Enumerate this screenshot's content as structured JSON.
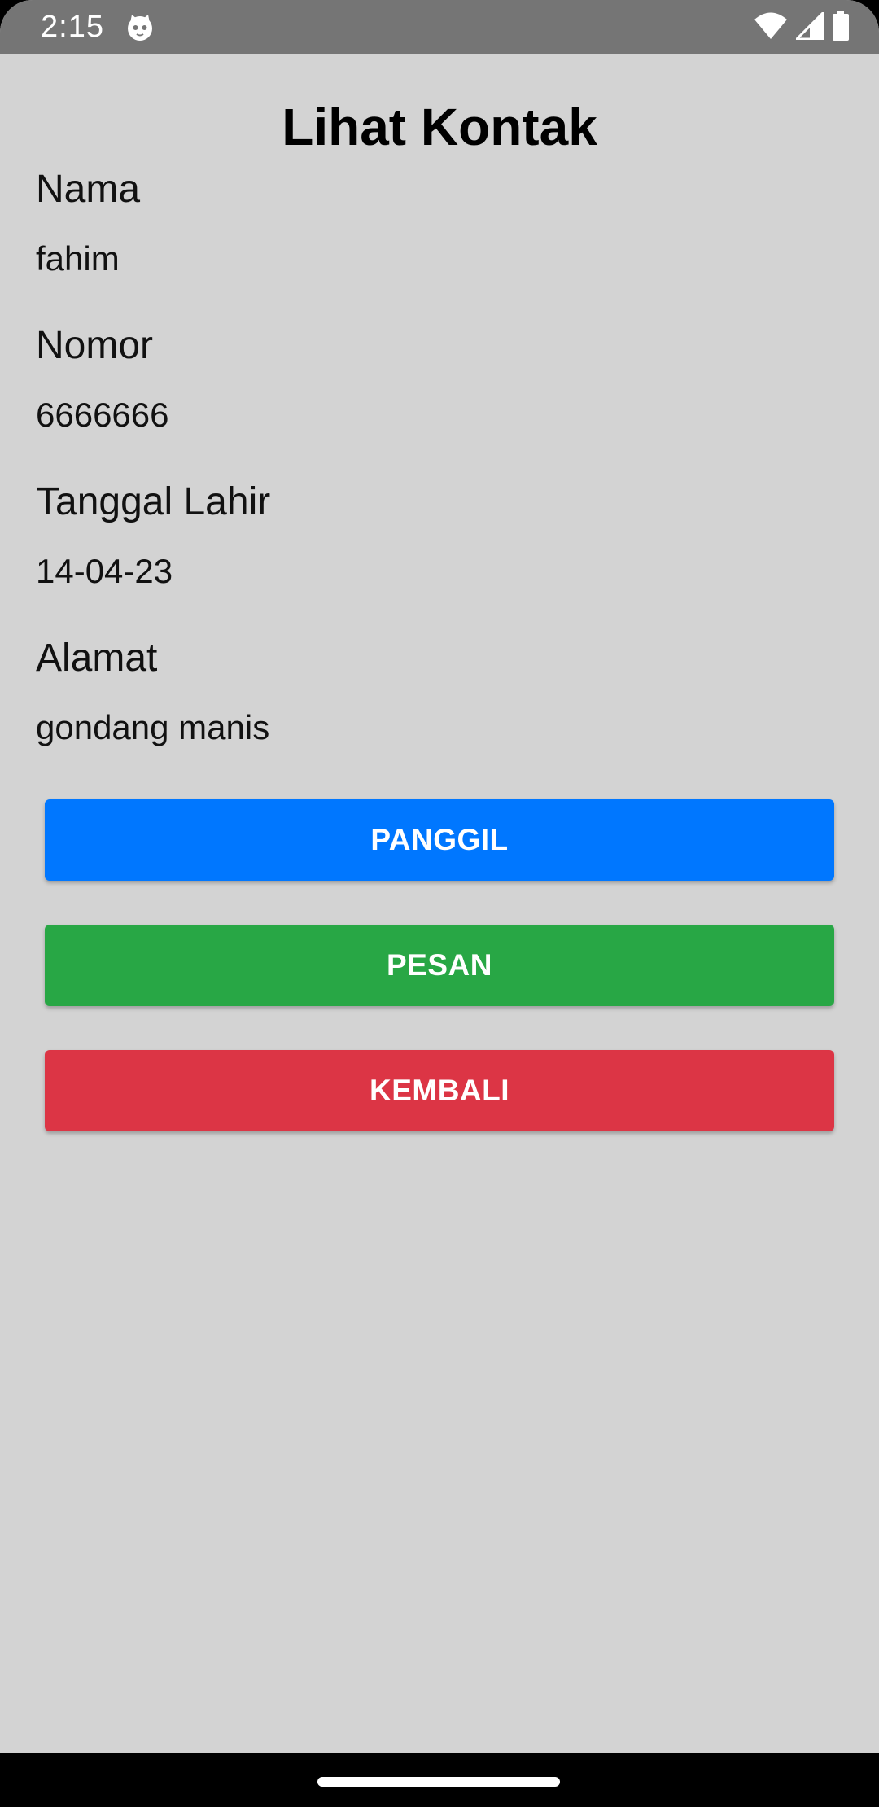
{
  "status_bar": {
    "time": "2:15",
    "icons": [
      "cat-app-icon",
      "wifi-icon",
      "cell-signal-icon",
      "battery-icon"
    ]
  },
  "page": {
    "title": "Lihat Kontak"
  },
  "fields": [
    {
      "label": "Nama",
      "value": "fahim"
    },
    {
      "label": "Nomor",
      "value": "6666666"
    },
    {
      "label": "Tanggal Lahir",
      "value": "14-04-23"
    },
    {
      "label": "Alamat",
      "value": "gondang manis"
    }
  ],
  "buttons": {
    "call": {
      "label": "PANGGIL",
      "color": "#0077ff"
    },
    "message": {
      "label": "PESAN",
      "color": "#28a745"
    },
    "back": {
      "label": "KEMBALI",
      "color": "#dc3545"
    }
  },
  "colors": {
    "background": "#d3d3d3",
    "status_bar": "#757575"
  }
}
